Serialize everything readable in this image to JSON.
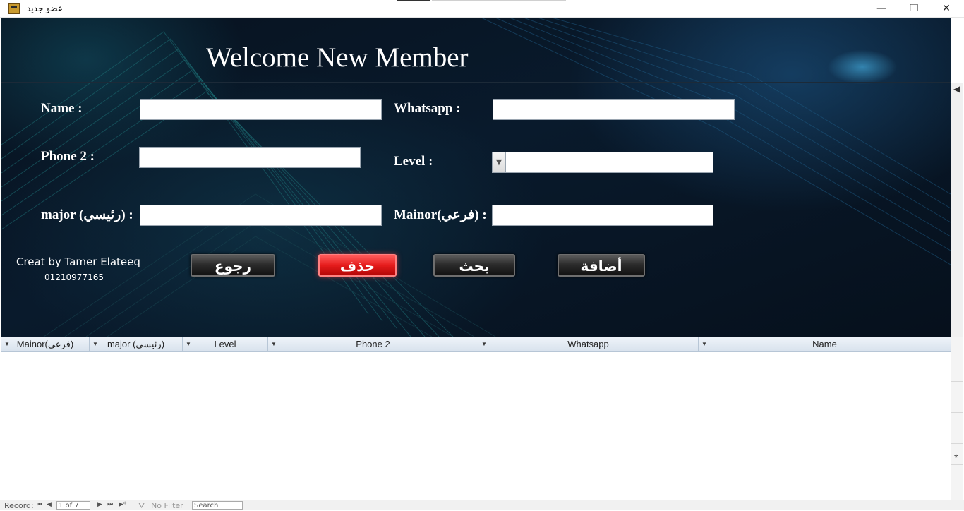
{
  "window": {
    "title": "عضو جديد",
    "controls": {
      "minimize": "—",
      "restore": "❐",
      "close": "✕"
    }
  },
  "form": {
    "heading": "Welcome New Member",
    "fields": {
      "name": {
        "label": "Name :",
        "value": ""
      },
      "whatsapp": {
        "label": "Whatsapp :",
        "value": ""
      },
      "phone2": {
        "label": "Phone  2 :",
        "value": ""
      },
      "level": {
        "label": "Level :",
        "value": ""
      },
      "major": {
        "label": "major (رئيسي) :",
        "value": ""
      },
      "minor": {
        "label": "Mainor(فرعي) :",
        "value": ""
      }
    },
    "credit": {
      "line1": "Creat by Tamer Elateeq",
      "line2": "01210977165"
    },
    "buttons": {
      "back": "رجوع",
      "delete": "حذف",
      "search": "بحث",
      "add": "أضافة"
    },
    "colors": {
      "delete_button": "#e51c1c",
      "background": "#07121f"
    }
  },
  "datasheet": {
    "columns": [
      "Mainor(فرعي)",
      "major (رئيسي)",
      "Level",
      "Phone  2",
      "Whatsapp",
      "Name"
    ],
    "rows": [],
    "new_row_marker": "*"
  },
  "statusbar": {
    "record_label": "Record:",
    "nav": {
      "first": "⏮",
      "prev": "◀",
      "next": "▶",
      "last": "⏭",
      "new": "▶*"
    },
    "record_value": "1 of 7",
    "filter": "No Filter",
    "search_placeholder": "Search"
  }
}
